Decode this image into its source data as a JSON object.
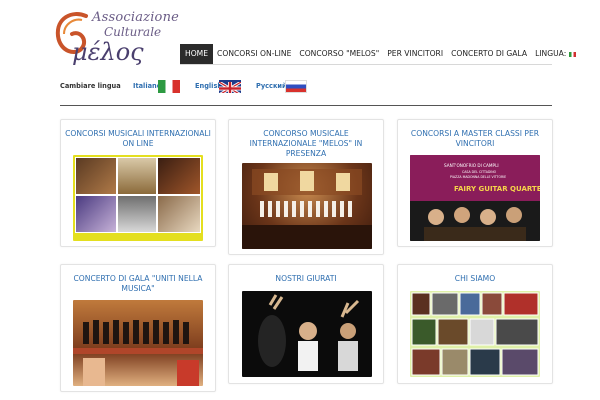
{
  "logo": {
    "line1": "Associazione",
    "line2": "Culturale",
    "line3": "μέλος"
  },
  "nav": {
    "items": [
      "HOME",
      "CONCORSI ON-LINE",
      "CONCORSO \"MELOS\"",
      "PER VINCITORI",
      "CONCERTO DI GALA"
    ],
    "language_label": "LINGUA:",
    "active": "HOME"
  },
  "language_bar": {
    "label": "Cambiare lingua",
    "options": [
      "Italiano",
      "English",
      "Русский"
    ]
  },
  "cards": [
    {
      "title": "CONCORSI MUSICALI INTERNAZIONALI ON LINE"
    },
    {
      "title": "CONCORSO MUSICALE INTERNAZIONALE \"MELOS\" IN PRESENZA"
    },
    {
      "title": "CONCORSI A MASTER CLASSI PER VINCITORI",
      "poster": {
        "top": "SANT'ONOFRIO DI CAMPLI",
        "sub1": "CASA DEL CITTADINO",
        "sub2": "PIAZZA MADONNA DELLE VITTORIE",
        "heading": "FAIRY GUITAR QUARTET"
      }
    },
    {
      "title": "CONCERTO DI GALA \"UNITI NELLA MUSICA\""
    },
    {
      "title": "NOSTRI GIURATI"
    },
    {
      "title": "CHI SIAMO"
    }
  ],
  "colors": {
    "link": "#2f6fb0",
    "nav_active_bg": "#2b2b2b",
    "logo_text": "#6a5c86"
  }
}
